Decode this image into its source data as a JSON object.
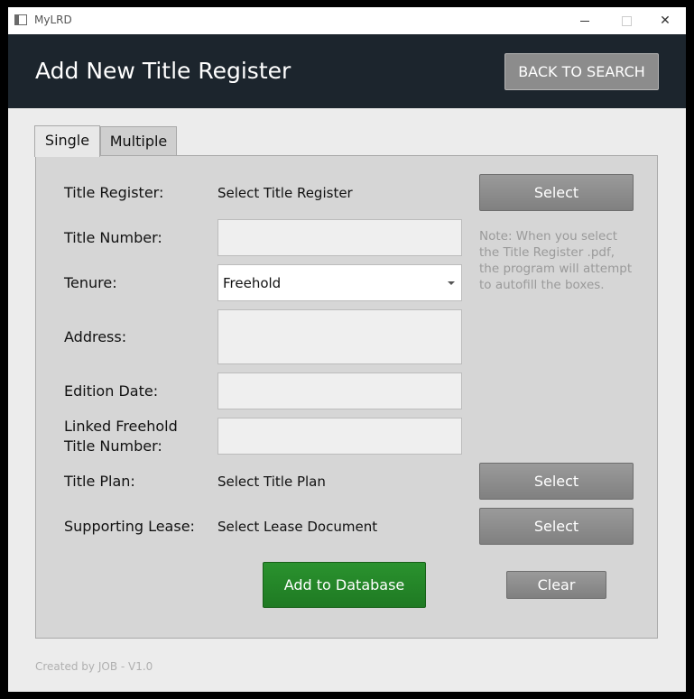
{
  "window": {
    "title": "MyLRD"
  },
  "header": {
    "title": "Add New Title Register",
    "back_label": "BACK TO SEARCH"
  },
  "tabs": [
    {
      "label": "Single"
    },
    {
      "label": "Multiple"
    }
  ],
  "form": {
    "title_register": {
      "label": "Title Register:",
      "value": "Select Title Register",
      "button": "Select"
    },
    "title_number": {
      "label": "Title Number:",
      "value": ""
    },
    "tenure": {
      "label": "Tenure:",
      "value": "Freehold"
    },
    "address": {
      "label": "Address:",
      "value": ""
    },
    "edition_date": {
      "label": "Edition Date:",
      "value": ""
    },
    "linked_freehold": {
      "label_line1": "Linked Freehold",
      "label_line2": "Title Number:",
      "value": ""
    },
    "title_plan": {
      "label": "Title Plan:",
      "value": "Select Title Plan",
      "button": "Select"
    },
    "supporting_lease": {
      "label": "Supporting Lease:",
      "value": "Select Lease Document",
      "button": "Select"
    },
    "note": "Note: When you select the Title Register .pdf, the program will attempt to autofill the boxes."
  },
  "actions": {
    "add_label": "Add to Database",
    "clear_label": "Clear"
  },
  "footer": {
    "text": "Created by JOB - V1.0"
  },
  "colors": {
    "header_bg": "#1c252d",
    "add_button": "#238a27",
    "panel_bg": "#d6d6d6"
  }
}
